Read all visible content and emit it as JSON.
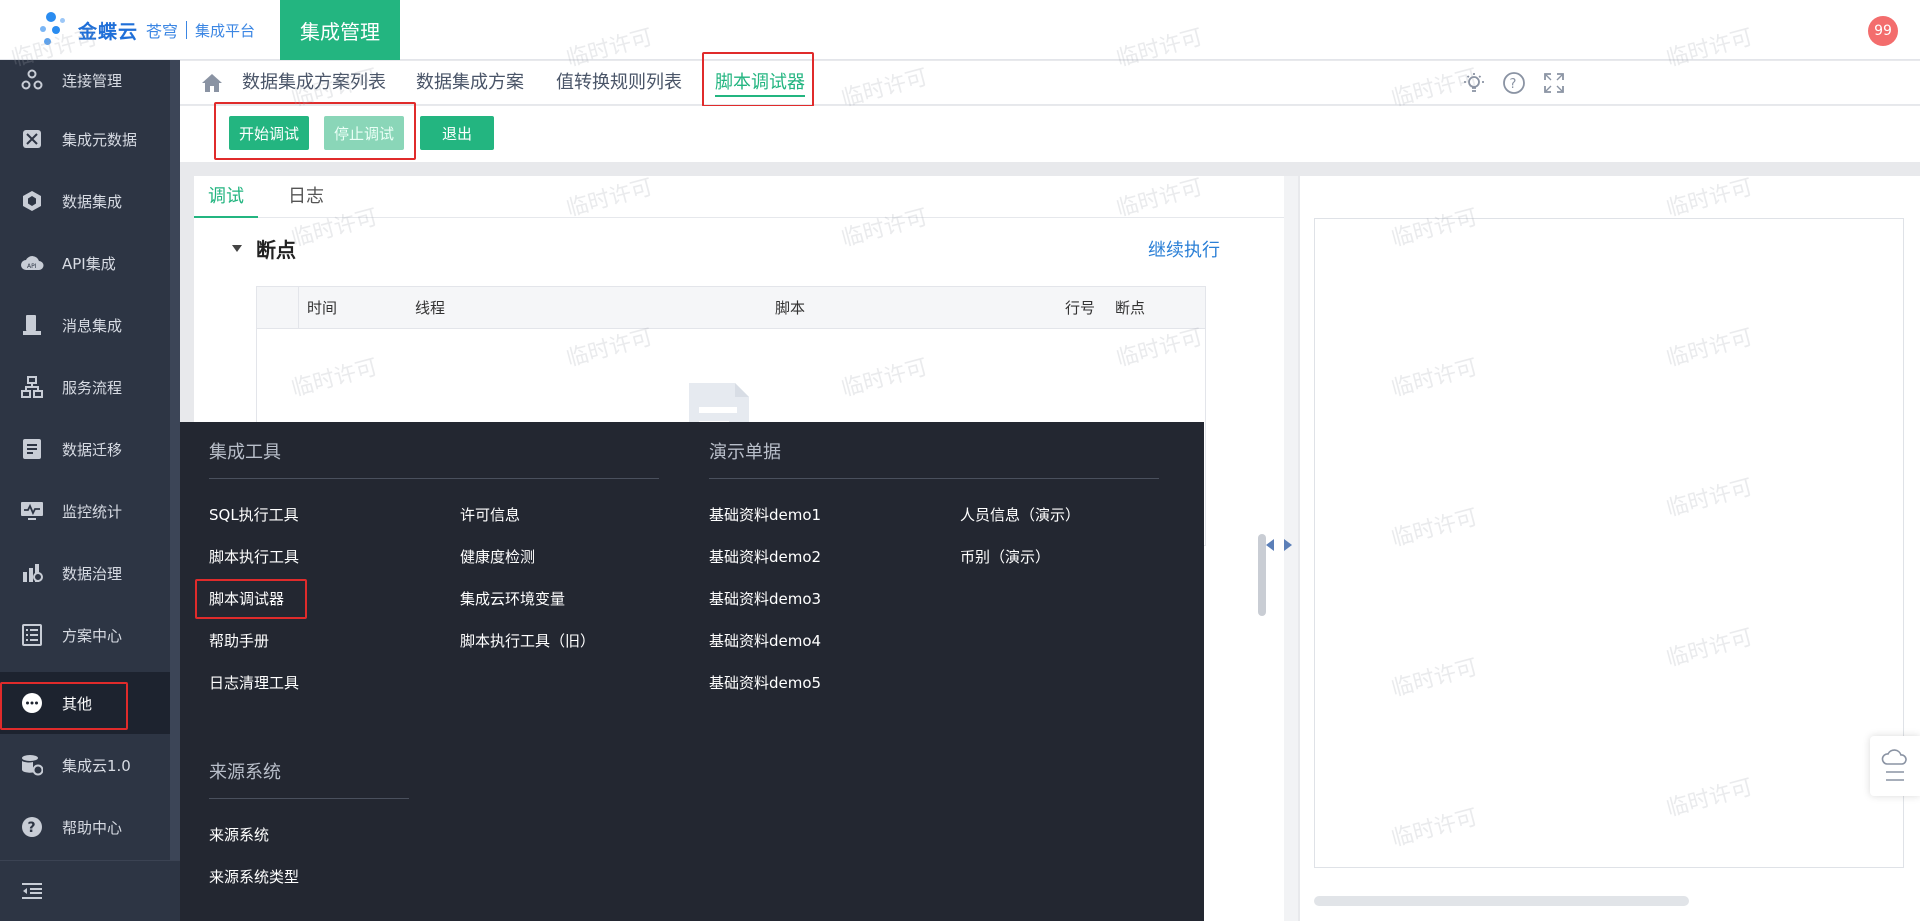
{
  "header": {
    "brand": "金蝶云",
    "brand_sub": "苍穹",
    "platform": "集成平台",
    "active_module": "集成管理",
    "user_badge": "99"
  },
  "sidebar": {
    "items": [
      {
        "label": "连接管理",
        "icon": "connection-icon"
      },
      {
        "label": "集成元数据",
        "icon": "metadata-icon"
      },
      {
        "label": "数据集成",
        "icon": "data-integration-icon"
      },
      {
        "label": "API集成",
        "icon": "api-cloud-icon"
      },
      {
        "label": "消息集成",
        "icon": "message-icon"
      },
      {
        "label": "服务流程",
        "icon": "workflow-icon"
      },
      {
        "label": "数据迁移",
        "icon": "migration-icon"
      },
      {
        "label": "监控统计",
        "icon": "monitor-icon"
      },
      {
        "label": "数据治理",
        "icon": "governance-icon"
      },
      {
        "label": "方案中心",
        "icon": "list-icon"
      },
      {
        "label": "其他",
        "icon": "more-icon"
      },
      {
        "label": "集成云1.0",
        "icon": "database-gear-icon"
      },
      {
        "label": "帮助中心",
        "icon": "help-icon"
      }
    ],
    "active_index": 10
  },
  "tabs": [
    {
      "label": "数据集成方案列表"
    },
    {
      "label": "数据集成方案"
    },
    {
      "label": "值转换规则列表"
    },
    {
      "label": "脚本调试器"
    }
  ],
  "toolbar": {
    "start_debug": "开始调试",
    "stop_debug": "停止调试",
    "exit": "退出"
  },
  "debug_panel": {
    "tab_debug": "调试",
    "tab_log": "日志",
    "section_title": "断点",
    "continue_label": "继续执行",
    "columns": [
      "时间",
      "线程",
      "脚本",
      "行号",
      "断点"
    ]
  },
  "menu": {
    "group1_title": "集成工具",
    "group1_col1": [
      "SQL执行工具",
      "脚本执行工具",
      "脚本调试器",
      "帮助手册",
      "日志清理工具"
    ],
    "group1_col2": [
      "许可信息",
      "健康度检测",
      "集成云环境变量",
      "脚本执行工具（旧）"
    ],
    "group2_title": "演示单据",
    "group2_col1": [
      "基础资料demo1",
      "基础资料demo2",
      "基础资料demo3",
      "基础资料demo4",
      "基础资料demo5"
    ],
    "group2_col2": [
      "人员信息（演示）",
      "币别（演示）"
    ],
    "group3_title": "来源系统",
    "group3_items": [
      "来源系统",
      "来源系统类型"
    ]
  },
  "watermark": "临时许可",
  "colors": {
    "accent": "#23b580",
    "sidebar_bg": "#2d3544",
    "menu_bg": "#232731",
    "highlight_border": "#e02b2b",
    "link": "#2a7fd6"
  }
}
